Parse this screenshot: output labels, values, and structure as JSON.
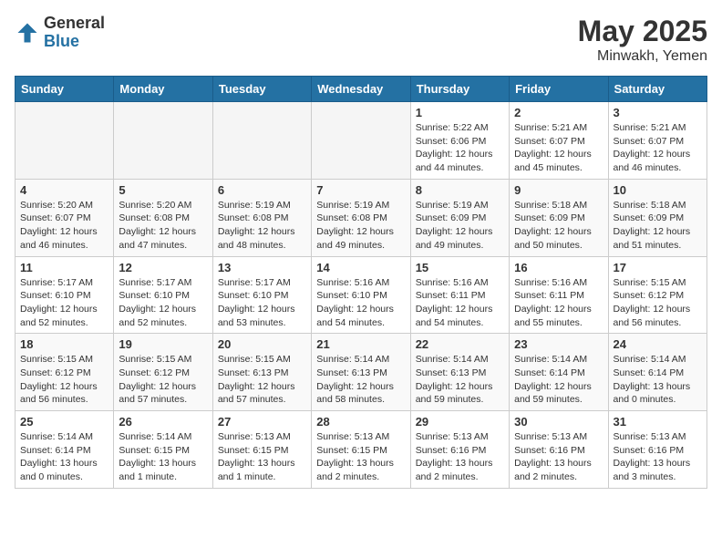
{
  "header": {
    "logo_general": "General",
    "logo_blue": "Blue",
    "month_title": "May 2025",
    "location": "Minwakh, Yemen"
  },
  "weekdays": [
    "Sunday",
    "Monday",
    "Tuesday",
    "Wednesday",
    "Thursday",
    "Friday",
    "Saturday"
  ],
  "weeks": [
    [
      {
        "day": "",
        "info": ""
      },
      {
        "day": "",
        "info": ""
      },
      {
        "day": "",
        "info": ""
      },
      {
        "day": "",
        "info": ""
      },
      {
        "day": "1",
        "info": "Sunrise: 5:22 AM\nSunset: 6:06 PM\nDaylight: 12 hours\nand 44 minutes."
      },
      {
        "day": "2",
        "info": "Sunrise: 5:21 AM\nSunset: 6:07 PM\nDaylight: 12 hours\nand 45 minutes."
      },
      {
        "day": "3",
        "info": "Sunrise: 5:21 AM\nSunset: 6:07 PM\nDaylight: 12 hours\nand 46 minutes."
      }
    ],
    [
      {
        "day": "4",
        "info": "Sunrise: 5:20 AM\nSunset: 6:07 PM\nDaylight: 12 hours\nand 46 minutes."
      },
      {
        "day": "5",
        "info": "Sunrise: 5:20 AM\nSunset: 6:08 PM\nDaylight: 12 hours\nand 47 minutes."
      },
      {
        "day": "6",
        "info": "Sunrise: 5:19 AM\nSunset: 6:08 PM\nDaylight: 12 hours\nand 48 minutes."
      },
      {
        "day": "7",
        "info": "Sunrise: 5:19 AM\nSunset: 6:08 PM\nDaylight: 12 hours\nand 49 minutes."
      },
      {
        "day": "8",
        "info": "Sunrise: 5:19 AM\nSunset: 6:09 PM\nDaylight: 12 hours\nand 49 minutes."
      },
      {
        "day": "9",
        "info": "Sunrise: 5:18 AM\nSunset: 6:09 PM\nDaylight: 12 hours\nand 50 minutes."
      },
      {
        "day": "10",
        "info": "Sunrise: 5:18 AM\nSunset: 6:09 PM\nDaylight: 12 hours\nand 51 minutes."
      }
    ],
    [
      {
        "day": "11",
        "info": "Sunrise: 5:17 AM\nSunset: 6:10 PM\nDaylight: 12 hours\nand 52 minutes."
      },
      {
        "day": "12",
        "info": "Sunrise: 5:17 AM\nSunset: 6:10 PM\nDaylight: 12 hours\nand 52 minutes."
      },
      {
        "day": "13",
        "info": "Sunrise: 5:17 AM\nSunset: 6:10 PM\nDaylight: 12 hours\nand 53 minutes."
      },
      {
        "day": "14",
        "info": "Sunrise: 5:16 AM\nSunset: 6:10 PM\nDaylight: 12 hours\nand 54 minutes."
      },
      {
        "day": "15",
        "info": "Sunrise: 5:16 AM\nSunset: 6:11 PM\nDaylight: 12 hours\nand 54 minutes."
      },
      {
        "day": "16",
        "info": "Sunrise: 5:16 AM\nSunset: 6:11 PM\nDaylight: 12 hours\nand 55 minutes."
      },
      {
        "day": "17",
        "info": "Sunrise: 5:15 AM\nSunset: 6:12 PM\nDaylight: 12 hours\nand 56 minutes."
      }
    ],
    [
      {
        "day": "18",
        "info": "Sunrise: 5:15 AM\nSunset: 6:12 PM\nDaylight: 12 hours\nand 56 minutes."
      },
      {
        "day": "19",
        "info": "Sunrise: 5:15 AM\nSunset: 6:12 PM\nDaylight: 12 hours\nand 57 minutes."
      },
      {
        "day": "20",
        "info": "Sunrise: 5:15 AM\nSunset: 6:13 PM\nDaylight: 12 hours\nand 57 minutes."
      },
      {
        "day": "21",
        "info": "Sunrise: 5:14 AM\nSunset: 6:13 PM\nDaylight: 12 hours\nand 58 minutes."
      },
      {
        "day": "22",
        "info": "Sunrise: 5:14 AM\nSunset: 6:13 PM\nDaylight: 12 hours\nand 59 minutes."
      },
      {
        "day": "23",
        "info": "Sunrise: 5:14 AM\nSunset: 6:14 PM\nDaylight: 12 hours\nand 59 minutes."
      },
      {
        "day": "24",
        "info": "Sunrise: 5:14 AM\nSunset: 6:14 PM\nDaylight: 13 hours\nand 0 minutes."
      }
    ],
    [
      {
        "day": "25",
        "info": "Sunrise: 5:14 AM\nSunset: 6:14 PM\nDaylight: 13 hours\nand 0 minutes."
      },
      {
        "day": "26",
        "info": "Sunrise: 5:14 AM\nSunset: 6:15 PM\nDaylight: 13 hours\nand 1 minute."
      },
      {
        "day": "27",
        "info": "Sunrise: 5:13 AM\nSunset: 6:15 PM\nDaylight: 13 hours\nand 1 minute."
      },
      {
        "day": "28",
        "info": "Sunrise: 5:13 AM\nSunset: 6:15 PM\nDaylight: 13 hours\nand 2 minutes."
      },
      {
        "day": "29",
        "info": "Sunrise: 5:13 AM\nSunset: 6:16 PM\nDaylight: 13 hours\nand 2 minutes."
      },
      {
        "day": "30",
        "info": "Sunrise: 5:13 AM\nSunset: 6:16 PM\nDaylight: 13 hours\nand 2 minutes."
      },
      {
        "day": "31",
        "info": "Sunrise: 5:13 AM\nSunset: 6:16 PM\nDaylight: 13 hours\nand 3 minutes."
      }
    ]
  ]
}
